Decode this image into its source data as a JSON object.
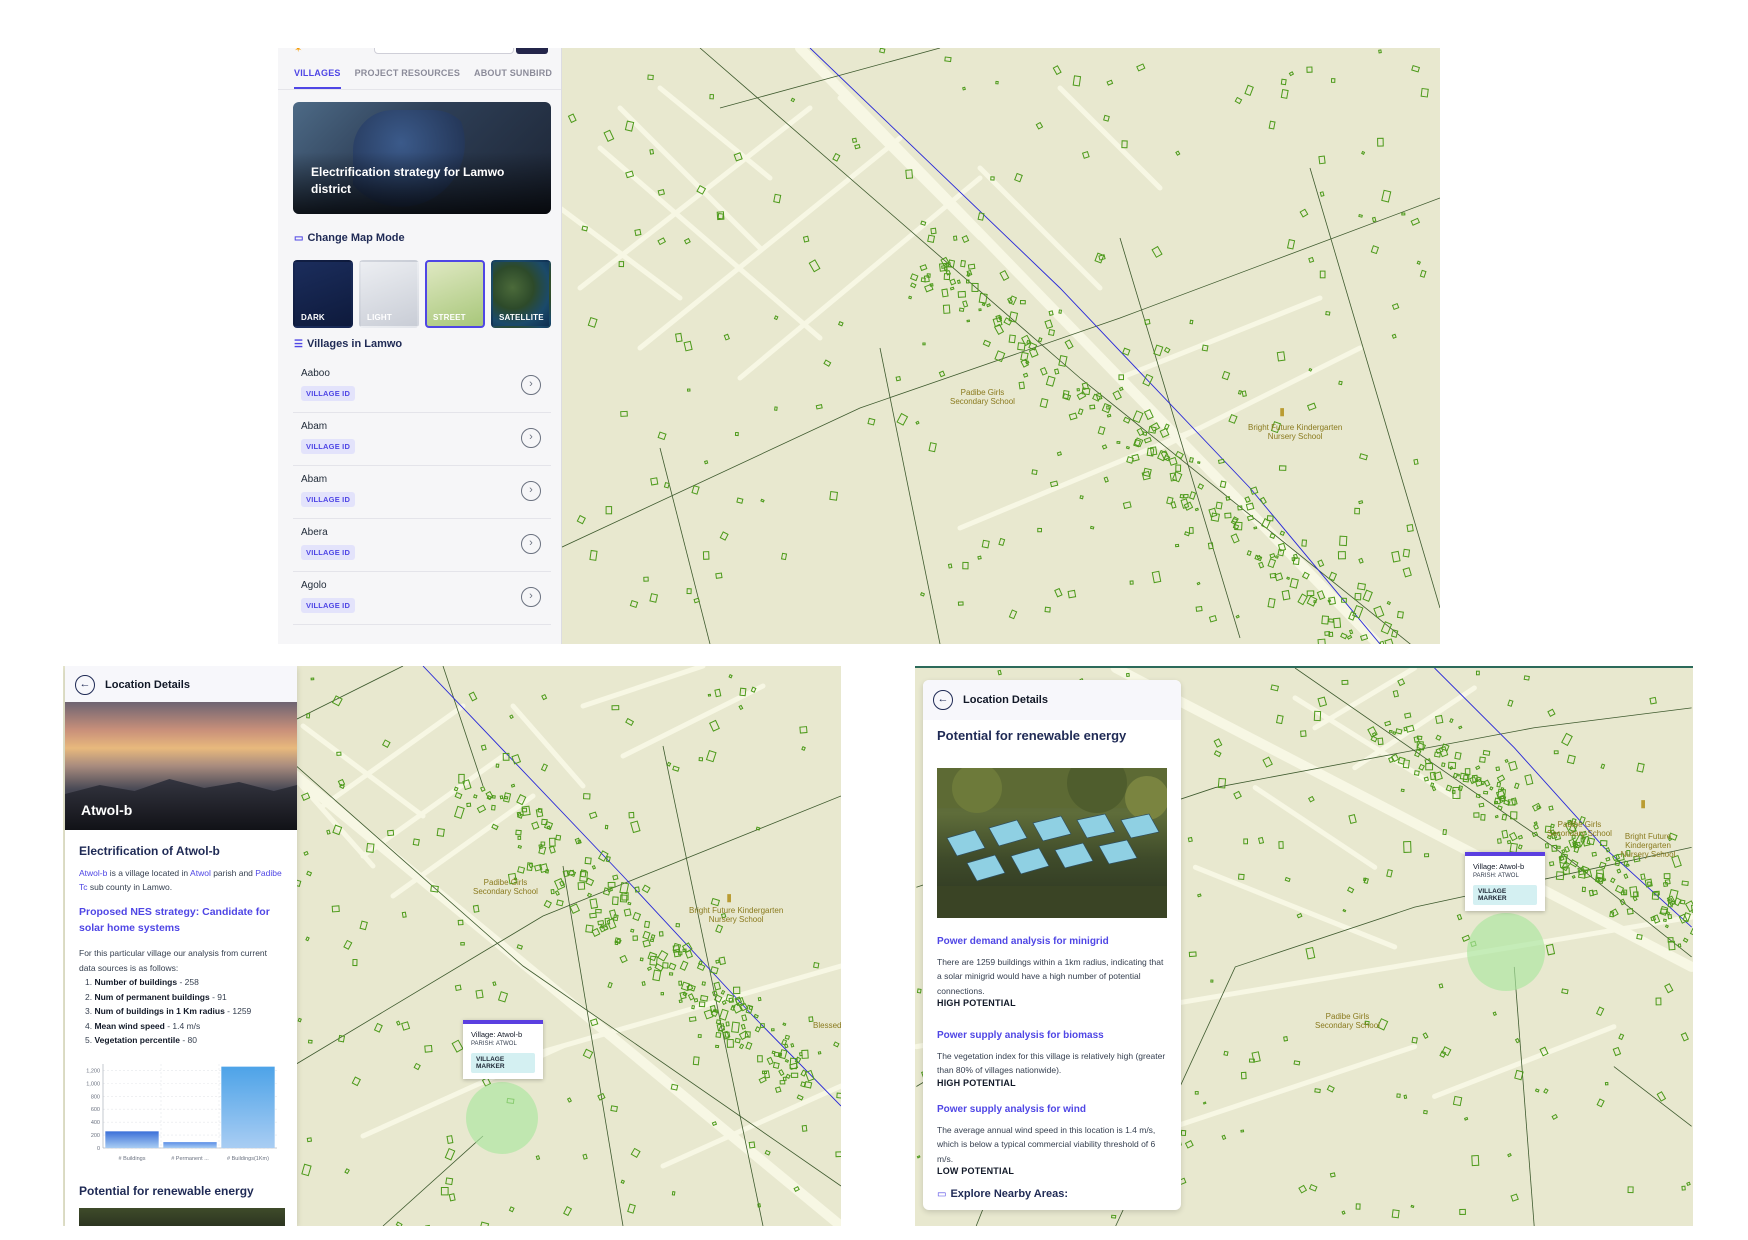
{
  "top": {
    "tabs": [
      {
        "label": "VILLAGES",
        "active": true
      },
      {
        "label": "PROJECT RESOURCES",
        "active": false
      },
      {
        "label": "ABOUT SUNBIRD",
        "active": false
      }
    ],
    "hero_title": "Electrification strategy for Lamwo district",
    "map_mode_heading": "Change Map Mode",
    "map_modes": [
      {
        "label": "DARK",
        "active": false
      },
      {
        "label": "LIGHT",
        "active": false
      },
      {
        "label": "STREET",
        "active": true
      },
      {
        "label": "SATELLITE",
        "active": false
      }
    ],
    "villages_heading": "Villages in Lamwo",
    "villages": [
      {
        "name": "Aaboo",
        "badge": "VILLAGE ID"
      },
      {
        "name": "Abam",
        "badge": "VILLAGE ID"
      },
      {
        "name": "Abam",
        "badge": "VILLAGE ID"
      },
      {
        "name": "Abera",
        "badge": "VILLAGE ID"
      },
      {
        "name": "Agolo",
        "badge": "VILLAGE ID"
      }
    ],
    "map_labels": {
      "school1": "Padibe Girls\nSecondary School",
      "school2": "Bright Future Kindergarten\nNursery School"
    }
  },
  "bottom_left": {
    "header_title": "Location Details",
    "village_title": "Atwol-b",
    "electrification_heading": "Electrification of Atwol-b",
    "intro": {
      "village_link": "Atwol-b",
      "text1": " is a village located in ",
      "parish_link": "Atwol",
      "text2": " parish and ",
      "subcounty_link": "Padibe Tc",
      "text3": " sub county in Lamwo."
    },
    "strategy_heading": "Proposed NES strategy: Candidate for solar home systems",
    "analysis_intro": "For this particular village our analysis from current data sources is as follows:",
    "stats": [
      {
        "num": "1.",
        "label": "Number of buildings",
        "value": " - 258"
      },
      {
        "num": "2.",
        "label": "Num of permanent buildings",
        "value": " - 91"
      },
      {
        "num": "3.",
        "label": "Num of buildings in 1 Km radius",
        "value": " - 1259"
      },
      {
        "num": "4.",
        "label": "Mean wind speed",
        "value": " - 1.4 m/s"
      },
      {
        "num": "5.",
        "label": "Vegetation percentile",
        "value": " - 80"
      }
    ],
    "renewable_heading": "Potential for renewable energy",
    "popup": {
      "title": "Village: Atwol-b",
      "parish": "PARISH: ATWOL",
      "badge": "VILLAGE MARKER"
    },
    "map_labels": {
      "school1": "Padibe Girls\nSecondary School",
      "school2": "Bright Future Kindergarten\nNursery School",
      "school3": "Blessed"
    }
  },
  "chart_data": {
    "type": "bar",
    "categories": [
      "# Buildings",
      "# Permanent ...",
      "# Buildings(1Km)"
    ],
    "values": [
      258,
      91,
      1259
    ],
    "ylim": [
      0,
      1300
    ],
    "yticks": [
      0,
      200,
      400,
      600,
      800,
      1000,
      1200
    ],
    "ytick_labels": [
      "0",
      "200",
      "400",
      "600",
      "800",
      "1,000",
      "1,200"
    ],
    "grid": true,
    "colors": [
      "#3b6fd8",
      "#5b8ee6",
      "#4da3e8"
    ]
  },
  "bottom_right": {
    "header_title": "Location Details",
    "renewable_heading": "Potential for renewable energy",
    "sections": [
      {
        "heading": "Power demand analysis for minigrid",
        "text": "There are 1259 buildings within a 1km radius, indicating that a solar minigrid would have a high number of potential connections.",
        "potential": "HIGH POTENTIAL"
      },
      {
        "heading": "Power supply analysis for biomass",
        "text": "The vegetation index for this village is relatively high (greater than 80% of villages nationwide).",
        "potential": "HIGH POTENTIAL"
      },
      {
        "heading": "Power supply analysis for wind",
        "text": "The average annual wind speed in this location is 1.4 m/s, which is below a typical commercial viability threshold of 6 m/s.",
        "potential": "LOW POTENTIAL"
      }
    ],
    "explore_heading": "Explore Nearby Areas:",
    "popup": {
      "title": "Village: Atwol-b",
      "parish": "PARISH: ATWOL",
      "badge": "VILLAGE MARKER"
    },
    "map_labels": {
      "school1": "Padibe Girls\nSecondary School",
      "school2": "Bright Future Kindergarten\nNursery School"
    }
  },
  "colors": {
    "accent": "#4f46e5",
    "map_bg": "#e8e8cf",
    "road": "#f7f7e4",
    "building": "#4c9a1a",
    "powerline": "#2828d8",
    "boundary": "#3e5a2e"
  }
}
